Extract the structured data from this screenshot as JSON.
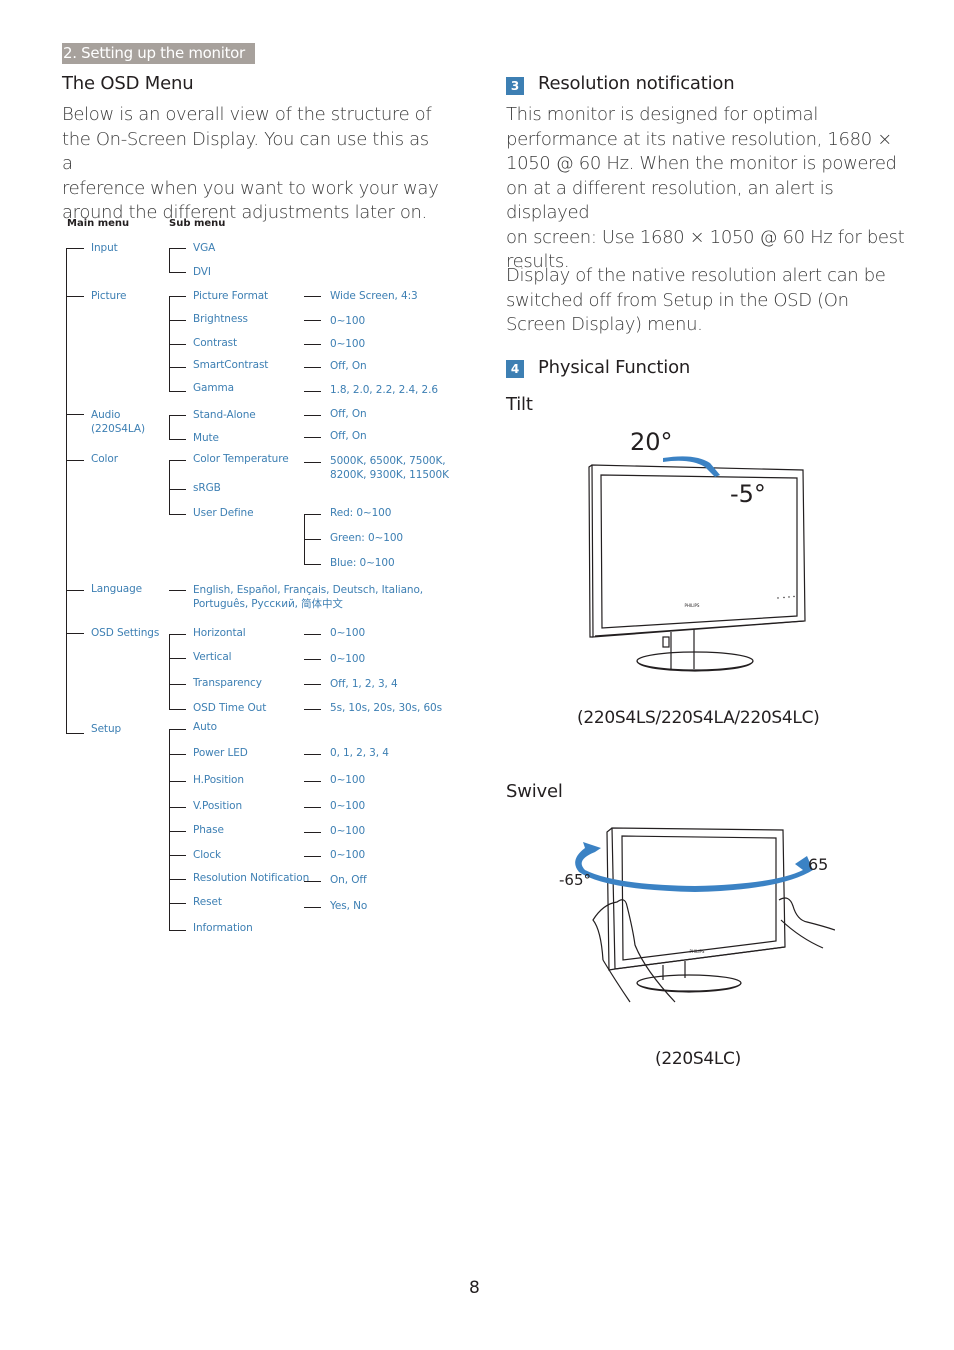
{
  "header": {
    "section_tab": "2. Setting up the monitor"
  },
  "left": {
    "title": "The OSD Menu",
    "intro": "Below is an overall view of the structure of the On-Screen Display. You can use this as a reference when you want to work your way around the different adjustments later on.",
    "intro_lines": [
      "Below is an overall view of the structure of",
      "the On-Screen Display. You can use this as a",
      "reference when you want to work your way",
      "around the different adjustments later on."
    ],
    "tree": {
      "main_menu_header": "Main menu",
      "sub_menu_header": "Sub menu",
      "main": [
        {
          "label": "Input",
          "subs": [
            {
              "label": "VGA"
            },
            {
              "label": "DVI"
            }
          ]
        },
        {
          "label": "Picture",
          "subs": [
            {
              "label": "Picture Format",
              "value": "Wide Screen, 4:3"
            },
            {
              "label": "Brightness",
              "value": "0~100"
            },
            {
              "label": "Contrast",
              "value": "0~100"
            },
            {
              "label": "SmartContrast",
              "value": "Off, On"
            },
            {
              "label": "Gamma",
              "value": "1.8, 2.0, 2.2, 2.4, 2.6"
            }
          ]
        },
        {
          "label": "Audio",
          "label2": "(220S4LA)",
          "subs": [
            {
              "label": "Stand-Alone",
              "value": "Off, On"
            },
            {
              "label": "Mute",
              "value": "Off, On"
            }
          ]
        },
        {
          "label": "Color",
          "subs": [
            {
              "label": "Color Temperature",
              "value": "5000K, 6500K, 7500K,",
              "value2": "8200K, 9300K, 11500K"
            },
            {
              "label": "sRGB"
            },
            {
              "label": "User Define",
              "values": [
                "Red: 0~100",
                "Green: 0~100",
                "Blue: 0~100"
              ]
            }
          ]
        },
        {
          "label": "Language",
          "direct": "English, Español, Français, Deutsch, Italiano,",
          "direct2": "Português, Русский, 简体中文"
        },
        {
          "label": "OSD Settings",
          "subs": [
            {
              "label": "Horizontal",
              "value": "0~100"
            },
            {
              "label": "Vertical",
              "value": "0~100"
            },
            {
              "label": "Transparency",
              "value": "Off, 1, 2, 3, 4"
            },
            {
              "label": "OSD Time Out",
              "value": "5s, 10s, 20s, 30s, 60s"
            }
          ]
        },
        {
          "label": "Setup",
          "subs": [
            {
              "label": "Auto"
            },
            {
              "label": "Power LED",
              "value": "0, 1, 2, 3, 4"
            },
            {
              "label": "H.Position",
              "value": "0~100"
            },
            {
              "label": "V.Position",
              "value": "0~100"
            },
            {
              "label": "Phase",
              "value": "0~100"
            },
            {
              "label": "Clock",
              "value": "0~100"
            },
            {
              "label": "Resolution Notification",
              "value": "On, Off"
            },
            {
              "label": "Reset",
              "value": "Yes, No"
            },
            {
              "label": "Information"
            }
          ]
        }
      ]
    }
  },
  "right": {
    "sec3": {
      "number": "3",
      "title": "Resolution notification",
      "para1_lines": [
        "This monitor is designed for optimal",
        "performance at its native resolution, 1680 ×",
        "1050 @ 60 Hz. When the monitor is powered",
        "on at a different resolution, an alert is displayed",
        "on screen: Use 1680 × 1050 @ 60 Hz for best",
        "results."
      ],
      "para2_lines": [
        "Display of the native resolution alert can be",
        "switched off from Setup in the OSD (On",
        "Screen Display) menu."
      ]
    },
    "sec4": {
      "number": "4",
      "title": "Physical Function"
    },
    "tilt": {
      "heading": "Tilt",
      "angle_up": "20°",
      "angle_down": "-5°",
      "caption": "(220S4LS/220S4LA/220S4LC)"
    },
    "swivel": {
      "heading": "Swivel",
      "angle_left": "-65°",
      "angle_right": "65",
      "caption": "(220S4LC)"
    },
    "brand_label": "PHILIPS"
  },
  "footer": {
    "page_number": "8"
  },
  "colors": {
    "accent": "#3d7fb3",
    "tab_bg": "#a7a19c",
    "arrow": "#3b82c4"
  }
}
